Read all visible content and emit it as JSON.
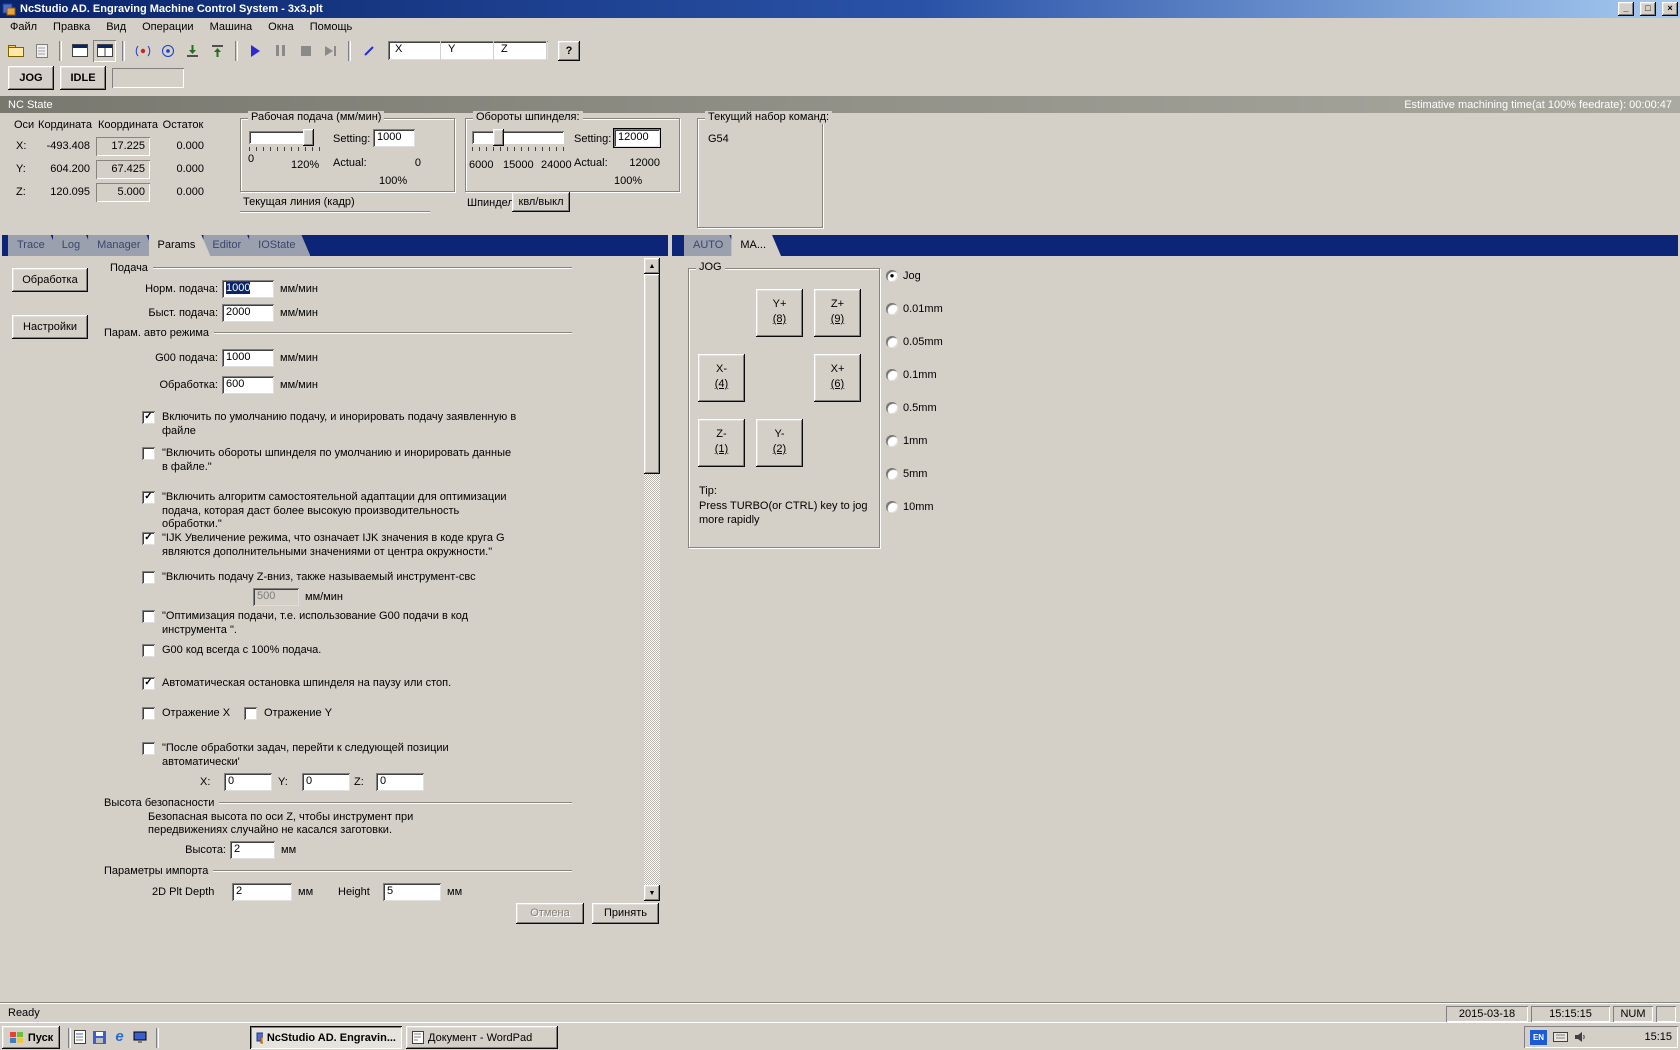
{
  "icons": {
    "minimize": "_",
    "maximize": "□",
    "close": "×",
    "help": "?",
    "scroll_up": "▲",
    "scroll_down": "▼",
    "ie": "e"
  },
  "titlebar": {
    "title": "NcStudio AD. Engraving Machine Control System  - 3x3.plt"
  },
  "menu": {
    "items": [
      {
        "label": "Файл"
      },
      {
        "label": "Правка"
      },
      {
        "label": "Вид"
      },
      {
        "label": "Операции"
      },
      {
        "label": "Машина"
      },
      {
        "label": "Окна"
      },
      {
        "label": "Помощь"
      }
    ]
  },
  "toolbar": {
    "axes": {
      "x": "X",
      "y": "Y",
      "z": "Z"
    }
  },
  "mode": {
    "jog_label": "JOG",
    "idle_label": "IDLE"
  },
  "nc_state": {
    "title": "NC State",
    "estimate": "Estimative machining time(at 100% feedrate): 00:00:47"
  },
  "coords": {
    "headers": {
      "axis": "Оси",
      "machine": "Кордината",
      "work": "Координата",
      "rest": "Остаток"
    },
    "rows": [
      {
        "axis": "X:",
        "machine": "-493.408",
        "work": "17.225",
        "rest": "0.000"
      },
      {
        "axis": "Y:",
        "machine": "604.200",
        "work": "67.425",
        "rest": "0.000"
      },
      {
        "axis": "Z:",
        "machine": "120.095",
        "work": "5.000",
        "rest": "0.000"
      }
    ]
  },
  "feed": {
    "title": "Рабочая подача (мм/мин)",
    "scale_start": "0",
    "scale_end": "120%",
    "setting_label": "Setting:",
    "setting_value": "1000",
    "actual_label": "Actual:",
    "actual_value": "0",
    "percent": "100%",
    "current_line_label": "Текущая линия (кадр)"
  },
  "spindle": {
    "title": "Обороты шпинделя:",
    "ticks": [
      "6000",
      "15000",
      "24000"
    ],
    "setting_label": "Setting:",
    "setting_value": "12000",
    "actual_label": "Actual:",
    "actual_value": "12000",
    "percent": "100%",
    "name_label": "Шпиндели",
    "toggle_label": "квл/выкл"
  },
  "commands": {
    "title": "Текущий набор команд:",
    "value": "G54"
  },
  "left_tabs": {
    "items": [
      {
        "label": "Trace"
      },
      {
        "label": "Log"
      },
      {
        "label": "Manager"
      },
      {
        "label": "Params"
      },
      {
        "label": "Editor"
      },
      {
        "label": "IOState"
      }
    ]
  },
  "sidebar": {
    "processing": "Обработка",
    "settings": "Настройки"
  },
  "params": {
    "feed_section": "Подача",
    "normal_feed_label": "Норм. подача:",
    "normal_feed_value": "1000",
    "fast_feed_label": "Быст. подача:",
    "fast_feed_value": "2000",
    "auto_section": "Парам. авто режима",
    "g00_feed_label": "G00 подача:",
    "g00_feed_value": "1000",
    "processing_label": "Обработка:",
    "processing_value": "600",
    "unit_mm_min": "мм/мин",
    "unit_mm": "мм",
    "checkboxes": [
      {
        "label": "Включить по умолчанию подачу, и инорировать подачу заявленную в файле",
        "checked": true,
        "mark": "✓"
      },
      {
        "label": "\"Включить обороты шпинделя по умолчанию и инорировать данные в файле.\"",
        "checked": false,
        "mark": ""
      },
      {
        "label": "\"Включить алгоритм самостоятельной адаптации для оптимизации подача, которая даст более высокую производительность обработки.\"",
        "checked": true,
        "mark": "✓"
      },
      {
        "label": "\"IJK Увеличение режима, что означает IJK значения в коде круга G являются дополнительными значениями от центра окружности.\"",
        "checked": true,
        "mark": "✓"
      },
      {
        "label": "\"Включить подачу Z-вниз, также называемый инструмент-свс",
        "checked": false,
        "mark": ""
      },
      {
        "label": "\"Оптимизация подачи, т.е. использование G00 подачи в код инструмента \".",
        "checked": false,
        "mark": ""
      },
      {
        "label": "G00 код всегда с 100% подача.",
        "checked": false,
        "mark": ""
      },
      {
        "label": "Автоматическая остановка шпинделя на паузу или стоп.",
        "checked": true,
        "mark": "✓"
      },
      {
        "label": "Отражение  X",
        "checked": false,
        "mark": ""
      },
      {
        "label": "Отражение Y",
        "checked": false,
        "mark": ""
      },
      {
        "label": "\"После обработки задач, перейти к следующей позиции автоматически'",
        "checked": false,
        "mark": ""
      }
    ],
    "zdown_value": "500",
    "pos": {
      "x_label": "X:",
      "x_value": "0",
      "y_label": "Y:",
      "y_value": "0",
      "z_label": "Z:",
      "z_value": "0"
    },
    "safety_section": "Высота безопасности",
    "safety_desc1": "Безопасная высота по оси Z, чтобы инструмент при",
    "safety_desc2": "передвижениях случайно не касался заготовки.",
    "height_label": "Высота:",
    "height_value": "2",
    "import_section": "Параметры импорта",
    "plt_depth_label": "2D Plt Depth",
    "plt_depth_value": "2",
    "plt_height_label": "Height",
    "plt_height_value": "5",
    "cancel_label": "Отмена",
    "apply_label": "Принять"
  },
  "right_tabs": {
    "items": [
      {
        "label": "AUTO"
      },
      {
        "label": "MA..."
      }
    ]
  },
  "jog": {
    "title": "JOG",
    "buttons": [
      {
        "axis": "Y+",
        "key": "(8)"
      },
      {
        "axis": "Z+",
        "key": "(9)"
      },
      {
        "axis": "X-",
        "key": "(4)"
      },
      {
        "axis": "X+",
        "key": "(6)"
      },
      {
        "axis": "Z-",
        "key": "(1)"
      },
      {
        "axis": "Y-",
        "key": "(2)"
      }
    ],
    "tip_title": "Tip:",
    "tip_line1": "Press TURBO(or CTRL) key to jog",
    "tip_line2": "more rapidly",
    "steps": [
      {
        "label": "Jog",
        "selected": true,
        "mark": "●"
      },
      {
        "label": "0.01mm",
        "selected": false,
        "mark": ""
      },
      {
        "label": "0.05mm",
        "selected": false,
        "mark": ""
      },
      {
        "label": "0.1mm",
        "selected": false,
        "mark": ""
      },
      {
        "label": "0.5mm",
        "selected": false,
        "mark": ""
      },
      {
        "label": "1mm",
        "selected": false,
        "mark": ""
      },
      {
        "label": "5mm",
        "selected": false,
        "mark": ""
      },
      {
        "label": "10mm",
        "selected": false,
        "mark": ""
      }
    ]
  },
  "statusbar": {
    "ready": "Ready",
    "date": "2015-03-18",
    "time": "15:15:15",
    "num": "NUM"
  },
  "taskbar": {
    "start": "Пуск",
    "tasks": [
      {
        "label": "NcStudio AD. Engravin..."
      },
      {
        "label": "Документ - WordPad"
      }
    ],
    "tray": {
      "lang": "EN",
      "clock": "15:15"
    }
  }
}
